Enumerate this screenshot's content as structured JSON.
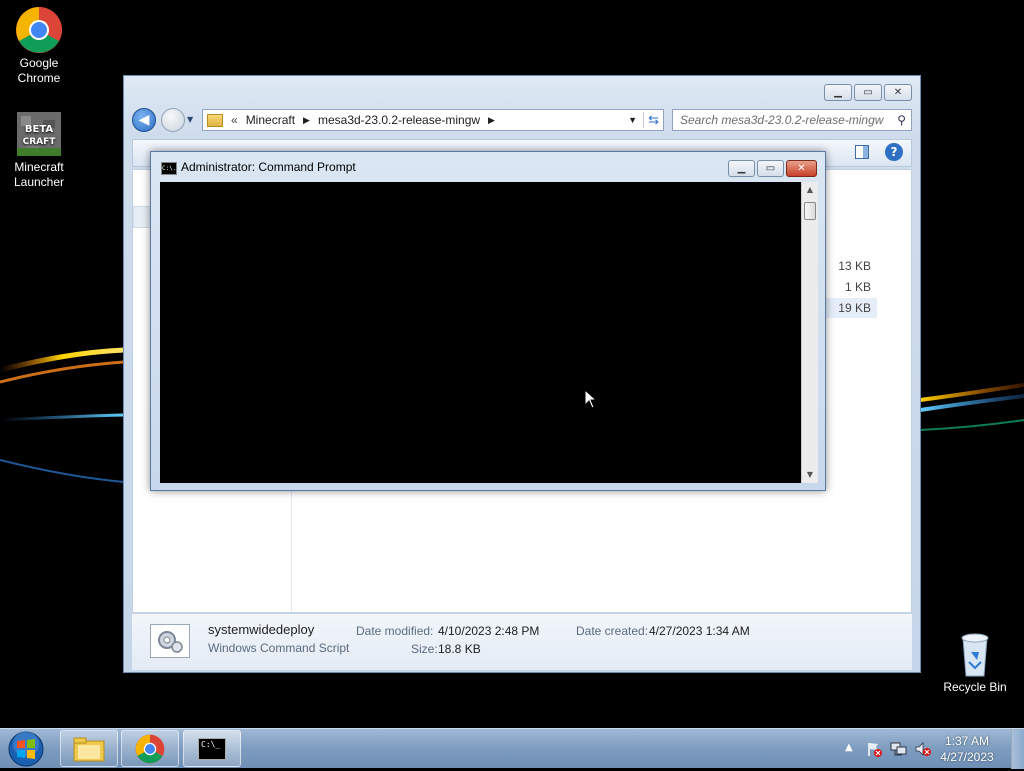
{
  "desktop": {
    "icons": [
      {
        "label_line1": "Google",
        "label_line2": "Chrome",
        "icon": "chrome-icon"
      },
      {
        "label_line1": "Minecraft",
        "label_line2": "Launcher",
        "icon": "minecraft-beta-craft-icon",
        "logo_text": "BETA CRAFT"
      },
      {
        "label_line1": "Recycle Bin",
        "label_line2": "",
        "icon": "recycle-bin-icon"
      }
    ]
  },
  "explorer": {
    "breadcrumb": {
      "overflow": "«",
      "items": [
        "Minecraft",
        "mesa3d-23.0.2-release-mingw"
      ]
    },
    "search_placeholder": "Search mesa3d-23.0.2-release-mingw",
    "file_sizes": [
      "13 KB",
      "1 KB",
      "19 KB"
    ],
    "details": {
      "file_name": "systemwidedeploy",
      "file_type": "Windows Command Script",
      "date_modified_label": "Date modified:",
      "date_modified": "4/10/2023 2:48 PM",
      "date_created_label": "Date created:",
      "date_created": "4/27/2023 1:34 AM",
      "size_label": "Size:",
      "size": "18.8 KB"
    }
  },
  "cmd": {
    "title": "Administrator:  Command Prompt",
    "icon_text": "C:\\."
  },
  "taskbar": {
    "buttons": [
      "windows-explorer-icon",
      "chrome-icon",
      "cmd-icon"
    ],
    "clock_time": "1:37 AM",
    "clock_date": "4/27/2023",
    "tray_icons": [
      "show-hidden-icons-chevron",
      "action-center-flag-icon",
      "network-icon",
      "volume-muted-icon"
    ]
  },
  "colors": {
    "accent_blue": "#2f6fc4",
    "close_red": "#c7402a",
    "console_bg": "#000000"
  }
}
